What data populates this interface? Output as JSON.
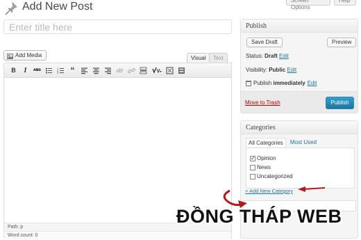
{
  "header": {
    "title": "Add New Post",
    "screen_options": "Screen Options",
    "help": "Help"
  },
  "title_input": {
    "placeholder": "Enter title here"
  },
  "editor": {
    "add_media_label": "Add Media",
    "tabs": [
      "Visual",
      "Text"
    ],
    "toolbar_icons": [
      "bold-icon",
      "italic-icon",
      "strikethrough-icon",
      "bullet-list-icon",
      "numbered-list-icon",
      "blockquote-icon",
      "align-left-icon",
      "align-center-icon",
      "align-right-icon",
      "link-icon",
      "unlink-icon",
      "read-more-icon",
      "spellcheck-icon",
      "fullscreen-icon",
      "kitchen-sink-icon"
    ],
    "path": "Path: p",
    "word_count": "Word count: 0"
  },
  "publish": {
    "heading": "Publish",
    "save_draft": "Save Draft",
    "preview": "Preview",
    "status_label": "Status: ",
    "status_value": "Draft",
    "visibility_label": "Visibility: ",
    "visibility_value": "Public",
    "schedule_label": "Publish ",
    "schedule_value": "immediately",
    "edit": "Edit",
    "move_to_trash": "Move to Trash",
    "publish_button": "Publish"
  },
  "categories": {
    "heading": "Categories",
    "tabs": [
      "All Categories",
      "Most Used"
    ],
    "items": [
      {
        "label": "Opinion",
        "checked": true
      },
      {
        "label": "News",
        "checked": false
      },
      {
        "label": "Uncategorized",
        "checked": false
      }
    ],
    "add_new": "+ Add New Category"
  },
  "watermark": "ĐỒNG THÁP WEB",
  "colors": {
    "link": "#21759b",
    "publish_button": "#21759b",
    "trash": "#bb0000",
    "annotation_arrow": "#b01c1c"
  }
}
